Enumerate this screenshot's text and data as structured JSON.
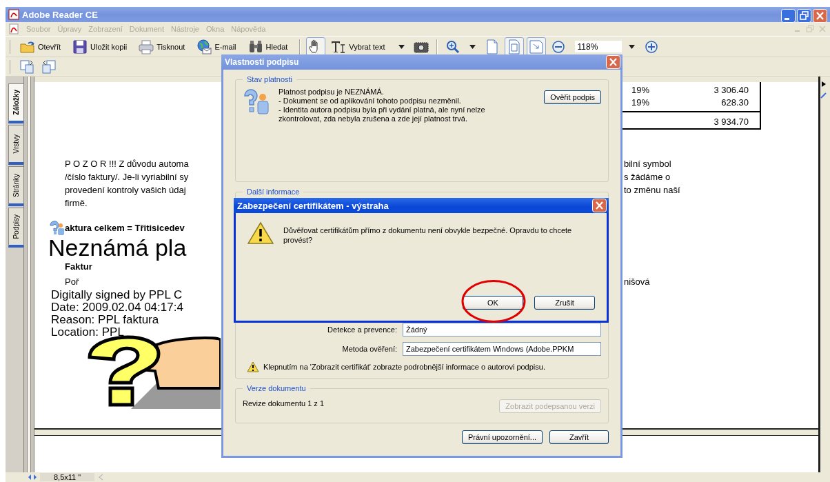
{
  "window": {
    "title": "Adobe Reader CE"
  },
  "menu": [
    {
      "label": "Soubor",
      "disabled": true
    },
    {
      "label": "Úpravy",
      "disabled": true
    },
    {
      "label": "Zobrazení",
      "disabled": true
    },
    {
      "label": "Dokument",
      "disabled": true
    },
    {
      "label": "Nástroje",
      "disabled": true
    },
    {
      "label": "Okna",
      "disabled": true
    },
    {
      "label": "Nápověda",
      "disabled": true
    }
  ],
  "toolbar": [
    {
      "kind": "button",
      "label": "Otevřít"
    },
    {
      "kind": "button",
      "label": "Uložit kopii"
    },
    {
      "kind": "button",
      "label": "Tisknout"
    },
    {
      "kind": "button",
      "label": "E-mail"
    },
    {
      "kind": "button",
      "label": "Hledat"
    },
    {
      "kind": "separator"
    },
    {
      "kind": "icon",
      "selected": true
    },
    {
      "kind": "button",
      "label": "Vybrat text"
    },
    {
      "kind": "caret"
    },
    {
      "kind": "icon",
      "selected": false
    },
    {
      "kind": "separator"
    },
    {
      "kind": "icon",
      "selected": false
    },
    {
      "kind": "caret"
    },
    {
      "kind": "icon",
      "selected": false
    },
    {
      "kind": "icon",
      "selected": true
    },
    {
      "kind": "icon",
      "selected": true
    },
    {
      "kind": "icon",
      "selected": false
    },
    {
      "kind": "field",
      "value": "118%"
    },
    {
      "kind": "caret"
    },
    {
      "kind": "icon",
      "selected": false
    }
  ],
  "toolbar2": [
    {
      "kind": "icon",
      "selected": false
    },
    {
      "kind": "icon",
      "selected": false
    }
  ],
  "side_tabs": [
    {
      "label": "Záložky",
      "selected": true
    },
    {
      "label": "Vrstvy",
      "selected": false
    },
    {
      "label": "Stránky",
      "selected": false
    },
    {
      "label": "Podpisy",
      "selected": false
    }
  ],
  "document": {
    "table_rows": [
      {
        "rate": "19%",
        "amount": "3 306.40"
      },
      {
        "rate": "19%",
        "amount": "628.30"
      }
    ],
    "total": "3 934.70",
    "paragraph": [
      {
        "left": "P O Z O R !!! Z důvodu automa",
        "right": "bilní symbol"
      },
      {
        "left": "/číslo faktury/. Je-li vyriabilní sy",
        "right": "s žádáme o"
      },
      {
        "left": "provedení kontroly vašich údaj",
        "right": "to změnu naší"
      },
      {
        "left": "firmě."
      }
    ],
    "invoice_total": "aktura celkem = Třitisicedev",
    "invoice_label": "Faktur",
    "order_label": "Poř",
    "right_name": "nišová",
    "stamp": {
      "status": "Neznámá pla",
      "lines": [
        "Digitally signed by PPL C",
        "Date: 2009.02.04 04:17:4",
        "Reason: PPL faktura",
        "Location: PPL"
      ]
    }
  },
  "status_bar": {
    "page_size": "8,5x11 \""
  },
  "signature_dialog": {
    "title": "Vlastnosti podpisu",
    "validity": {
      "legend": "Stav platnosti",
      "lines": [
        "Platnost podpisu je NEZNÁMÁ.",
        "- Dokument se od aplikování tohoto podpisu nezměnil.",
        "- Identita autora podpisu byla při vydání platná, ale nyní nelze zkontrolovat, zda nebyla zrušena a zde její platnost trvá."
      ],
      "button": "Ověřit podpis"
    },
    "details": {
      "legend": "Další informace",
      "fields": [
        {
          "label": "Detekce a prevence:",
          "value": "Žádný"
        },
        {
          "label": "Metoda ověření:",
          "value": "Zabezpečení certifikátem Windows (Adobe.PPKM"
        }
      ],
      "notice": "Klepnutím na 'Zobrazit certifikát' zobrazte podrobnější informace o autorovi podpisu."
    },
    "version": {
      "legend": "Verze dokumentu",
      "text": "Revize dokumentu 1 z 1",
      "button": {
        "label": "Zobrazit podepsanou verzi",
        "disabled": true
      }
    },
    "buttons": [
      "Právní upozornění...",
      "Zavřít"
    ]
  },
  "alert": {
    "title": "Zabezpečení certifikátem - výstraha",
    "message": "Důvěřovat certifikátům přímo z dokumentu není obvykle bezpečné. Opravdu to chcete provést?",
    "buttons": [
      {
        "label": "OK",
        "highlighted": true
      },
      {
        "label": "Zrušit",
        "highlighted": false
      }
    ]
  }
}
